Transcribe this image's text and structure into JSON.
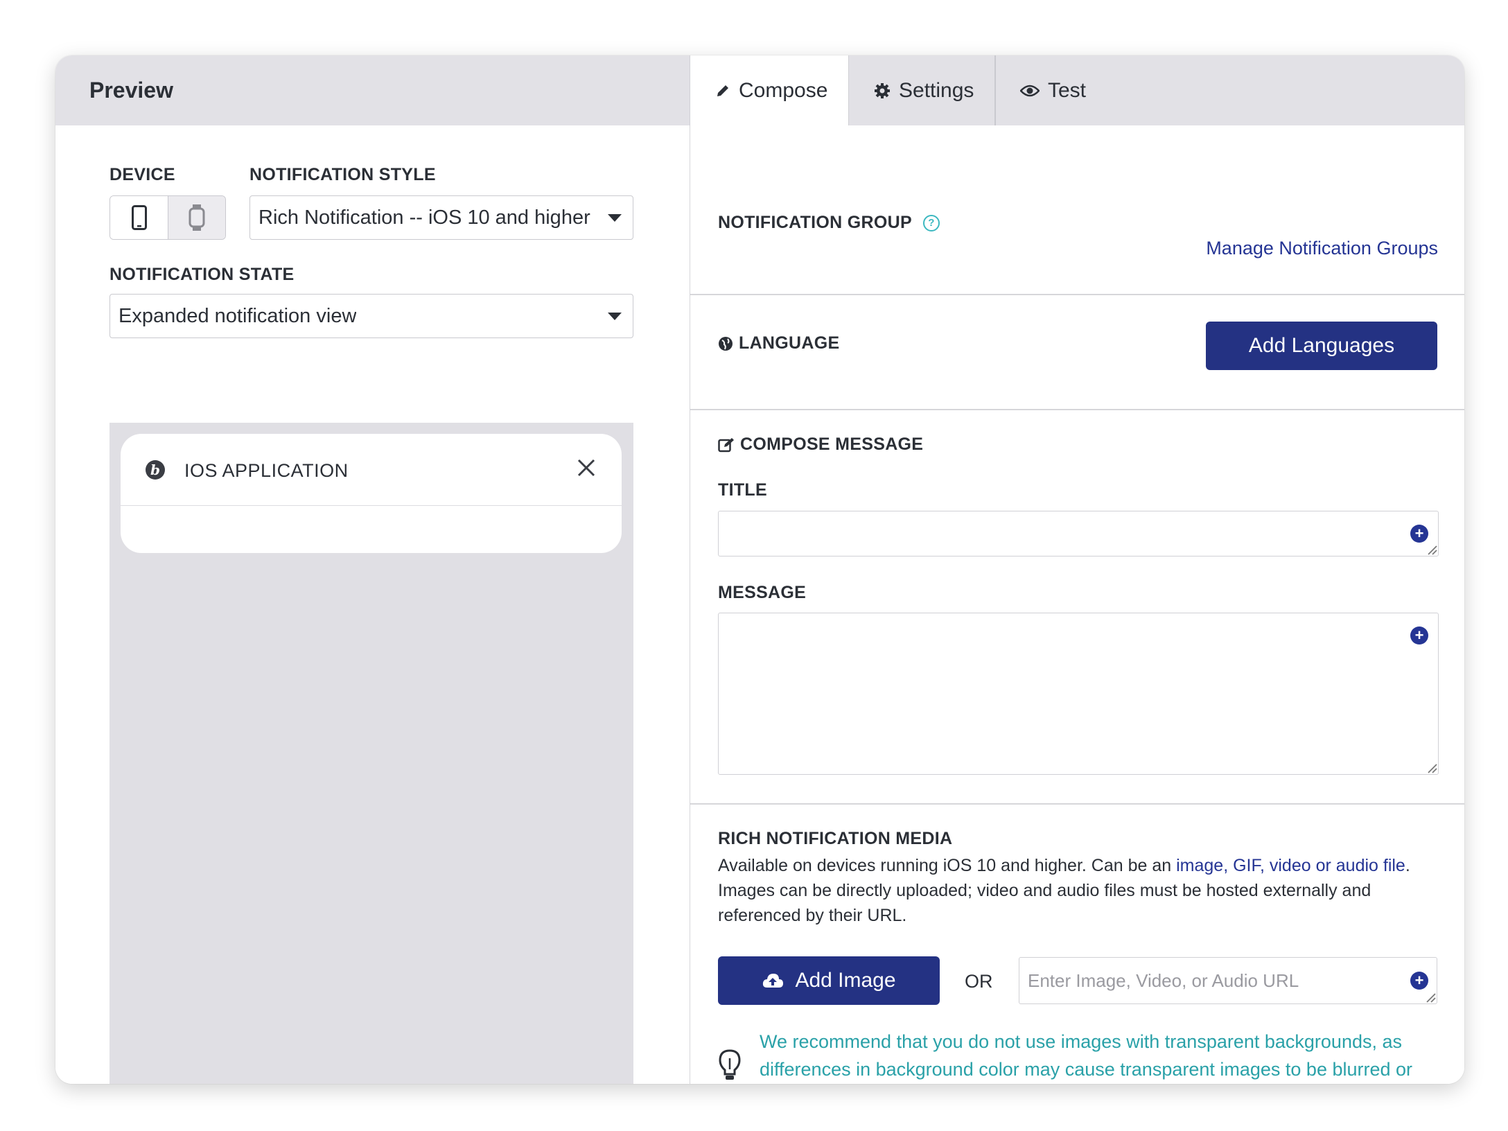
{
  "preview": {
    "title": "Preview",
    "device_label": "DEVICE",
    "style_label": "NOTIFICATION STYLE",
    "style_value": "Rich Notification -- iOS 10 and higher",
    "state_label": "NOTIFICATION STATE",
    "state_value": "Expanded notification view",
    "notification": {
      "app_name": "IOS APPLICATION"
    }
  },
  "tabs": [
    {
      "label": "Compose",
      "icon": "pencil-icon"
    },
    {
      "label": "Settings",
      "icon": "gear-icon"
    },
    {
      "label": "Test",
      "icon": "eye-icon"
    }
  ],
  "compose": {
    "group_label": "NOTIFICATION GROUP",
    "manage_groups_link": "Manage Notification Groups",
    "language_label": "LANGUAGE",
    "add_languages_button": "Add Languages",
    "compose_label": "COMPOSE MESSAGE",
    "title_label": "TITLE",
    "message_label": "MESSAGE",
    "media_label": "RICH NOTIFICATION MEDIA",
    "media_desc_pre": "Available on devices running iOS 10 and higher. Can be an ",
    "media_desc_link": "image, GIF, video or audio file",
    "media_desc_post": ". Images can be directly uploaded; video and audio files must be hosted externally and referenced by their URL.",
    "add_image_button": "Add Image",
    "or_text": "OR",
    "url_placeholder": "Enter Image, Video, or Audio URL",
    "tip": "We recommend that you do not use images with transparent backgrounds, as differences in background color may cause transparent images to be blurred or difficult to see on some devices."
  },
  "colors": {
    "primary": "#243283",
    "link": "#253594",
    "tip": "#2aa1a8",
    "header_bg": "#e2e1e6"
  }
}
